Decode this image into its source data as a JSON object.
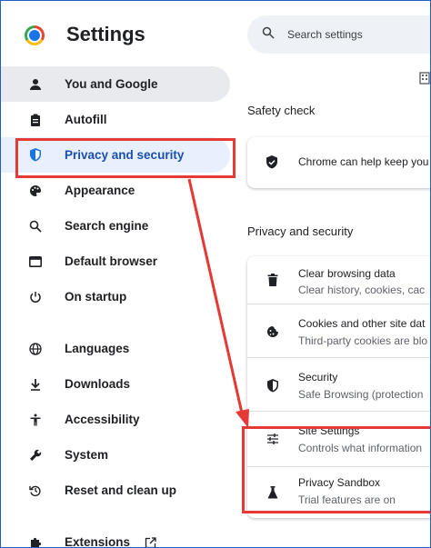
{
  "app": {
    "title": "Settings"
  },
  "search": {
    "placeholder": "Search settings"
  },
  "sidebar": {
    "items": [
      {
        "label": "You and Google",
        "icon": "person-icon"
      },
      {
        "label": "Autofill",
        "icon": "clipboard-icon"
      },
      {
        "label": "Privacy and security",
        "icon": "shield-icon"
      },
      {
        "label": "Appearance",
        "icon": "palette-icon"
      },
      {
        "label": "Search engine",
        "icon": "search-icon"
      },
      {
        "label": "Default browser",
        "icon": "browser-window-icon"
      },
      {
        "label": "On startup",
        "icon": "power-icon"
      },
      {
        "label": "Languages",
        "icon": "globe-icon"
      },
      {
        "label": "Downloads",
        "icon": "download-icon"
      },
      {
        "label": "Accessibility",
        "icon": "accessibility-icon"
      },
      {
        "label": "System",
        "icon": "wrench-icon"
      },
      {
        "label": "Reset and clean up",
        "icon": "reset-icon"
      },
      {
        "label": "Extensions",
        "icon": "puzzle-icon"
      }
    ]
  },
  "main": {
    "safety_check": {
      "title": "Safety check",
      "row_text": "Chrome can help keep you"
    },
    "privacy": {
      "title": "Privacy and security",
      "rows": [
        {
          "title": "Clear browsing data",
          "subtitle": "Clear history, cookies, cac"
        },
        {
          "title": "Cookies and other site dat",
          "subtitle": "Third-party cookies are blo"
        },
        {
          "title": "Security",
          "subtitle": "Safe Browsing (protection"
        },
        {
          "title": "Site Settings",
          "subtitle": "Controls what information"
        },
        {
          "title": "Privacy Sandbox",
          "subtitle": "Trial features are on"
        }
      ]
    }
  },
  "colors": {
    "accent": "#1a73e8",
    "active_bg": "#e8f0fe",
    "annotation": "#e53935"
  }
}
